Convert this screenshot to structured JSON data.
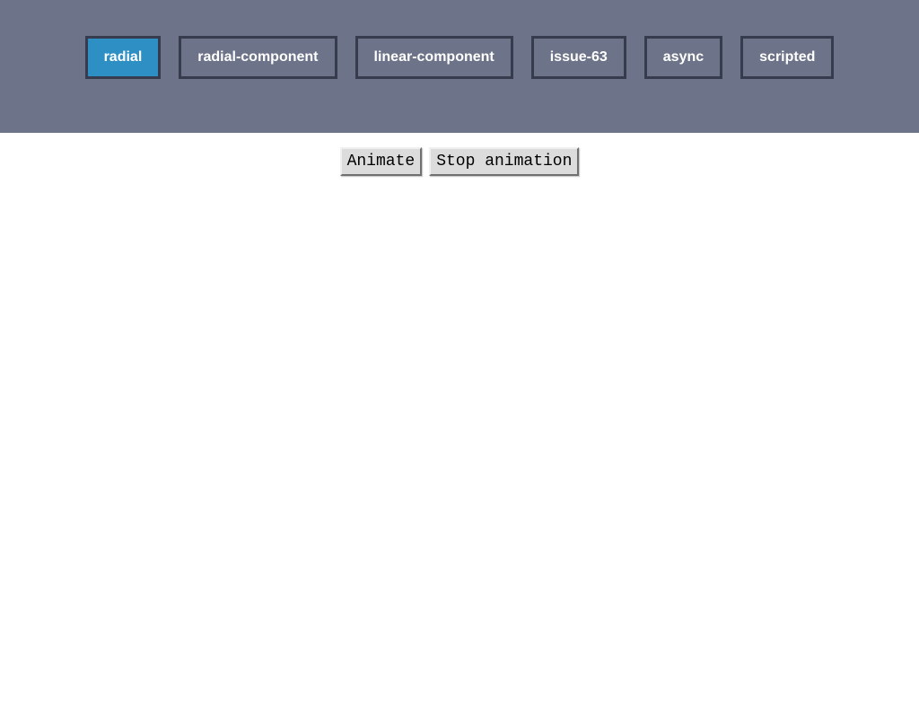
{
  "tabs": [
    {
      "label": "radial",
      "active": true
    },
    {
      "label": "radial-component",
      "active": false
    },
    {
      "label": "linear-component",
      "active": false
    },
    {
      "label": "issue-63",
      "active": false
    },
    {
      "label": "async",
      "active": false
    },
    {
      "label": "scripted",
      "active": false
    }
  ],
  "buttons": {
    "animate_label": "Animate",
    "stop_label": "Stop animation"
  }
}
